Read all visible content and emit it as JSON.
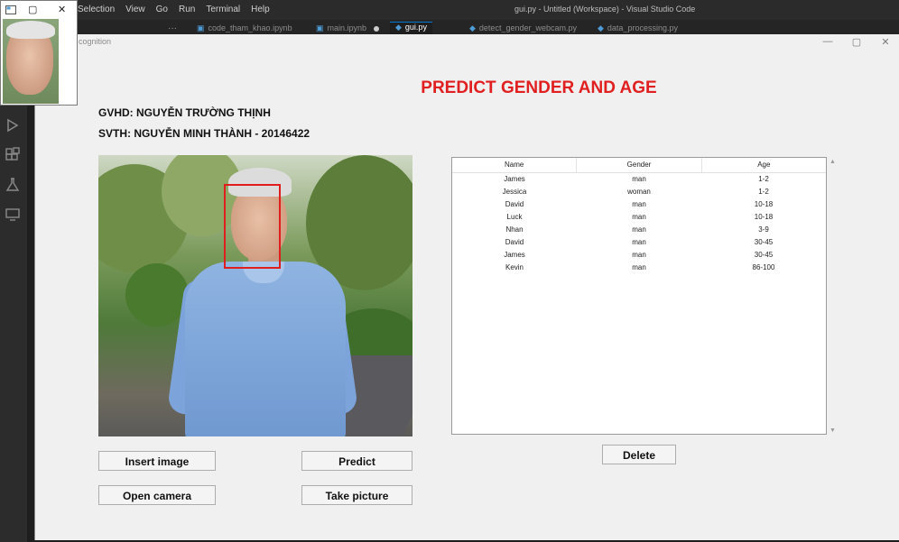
{
  "vscode": {
    "menu": [
      "Selection",
      "View",
      "Go",
      "Run",
      "Terminal",
      "Help"
    ],
    "window_title": "gui.py - Untitled (Workspace) - Visual Studio Code",
    "tabs": [
      {
        "label": "code_tham_khao.ipynb",
        "active": false,
        "modified": false
      },
      {
        "label": "main.ipynb",
        "active": false,
        "modified": true
      },
      {
        "label": "gui.py",
        "active": true,
        "modified": false
      },
      {
        "label": "detect_gender_webcam.py",
        "active": false,
        "modified": false
      },
      {
        "label": "data_processing.py",
        "active": false,
        "modified": false
      }
    ],
    "overflow_label": "···"
  },
  "app": {
    "window_title": "cognition",
    "window_controls": {
      "minimize": "—",
      "maximize": "▢",
      "close": "✕"
    },
    "heading": "PREDICT GENDER AND AGE",
    "gvhd": "GVHD: NGUYỄN TRƯỜNG THỊNH",
    "svth": "SVTH: NGUYỄN MINH THÀNH  -  20146422",
    "buttons": {
      "insert": "Insert image",
      "predict": "Predict",
      "open_camera": "Open camera",
      "take_picture": "Take picture",
      "delete": "Delete"
    },
    "table": {
      "columns": [
        "Name",
        "Gender",
        "Age"
      ],
      "rows": [
        [
          "James",
          "man",
          "1-2"
        ],
        [
          "Jessica",
          "woman",
          "1-2"
        ],
        [
          "David",
          "man",
          "10-18"
        ],
        [
          "Luck",
          "man",
          "10-18"
        ],
        [
          "Nhan",
          "man",
          "3-9"
        ],
        [
          "David",
          "man",
          "30-45"
        ],
        [
          "James",
          "man",
          "30-45"
        ],
        [
          "Kevin",
          "man",
          "86-100"
        ]
      ]
    },
    "colors": {
      "heading": "#e02020",
      "face_box": "#e01e1e"
    }
  },
  "camera_popup": {
    "controls": {
      "restore": "▢",
      "close": "✕"
    }
  }
}
